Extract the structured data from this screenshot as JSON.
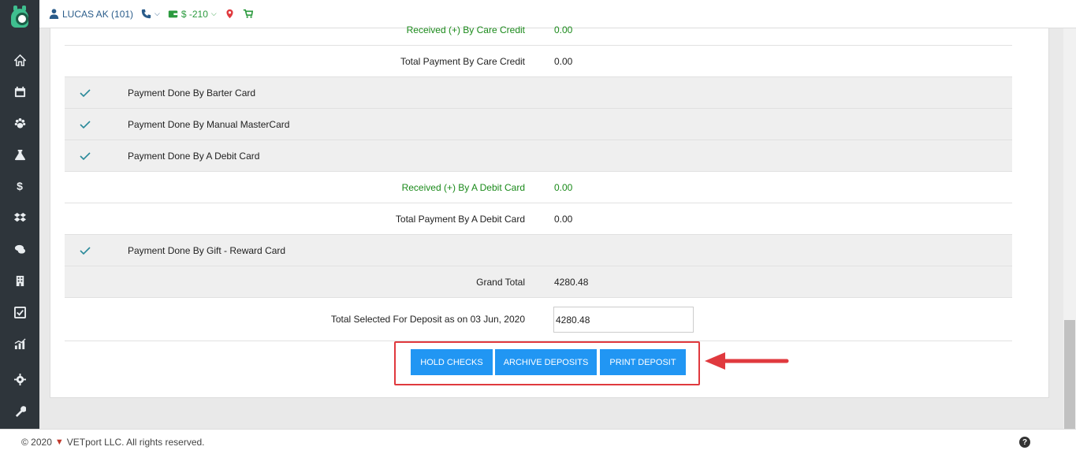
{
  "topbar": {
    "user": "LUCAS AK (101)",
    "balance": "$ -210"
  },
  "rows": [
    {
      "type": "received",
      "label": "Received (+) By Care Credit",
      "value": "0.00"
    },
    {
      "type": "total",
      "label": "Total Payment By Care Credit",
      "value": "0.00"
    },
    {
      "type": "method",
      "label": "Payment Done By Barter Card"
    },
    {
      "type": "method",
      "label": "Payment Done By Manual MasterCard"
    },
    {
      "type": "method",
      "label": "Payment Done By A Debit Card"
    },
    {
      "type": "received",
      "label": "Received (+) By A Debit Card",
      "value": "0.00"
    },
    {
      "type": "total",
      "label": "Total Payment By A Debit Card",
      "value": "0.00"
    },
    {
      "type": "method",
      "label": "Payment Done By Gift - Reward Card"
    },
    {
      "type": "grand",
      "label": "Grand Total",
      "value": "4280.48"
    }
  ],
  "deposit": {
    "label": "Total Selected For Deposit as on 03 Jun, 2020",
    "value": "4280.48"
  },
  "buttons": {
    "hold_checks": "HOLD CHECKS",
    "archive_deposits": "ARCHIVE DEPOSITS",
    "print_deposit": "PRINT DEPOSIT"
  },
  "footer": {
    "copyright": "© 2020",
    "company": "VETport LLC. All rights reserved.",
    "help": "?"
  },
  "colors": {
    "primary_button": "#2196f3",
    "highlight": "#e0393e",
    "received_green": "#1a8a1a",
    "check_teal": "#2a8a9a",
    "sidebar": "#2e353b"
  }
}
